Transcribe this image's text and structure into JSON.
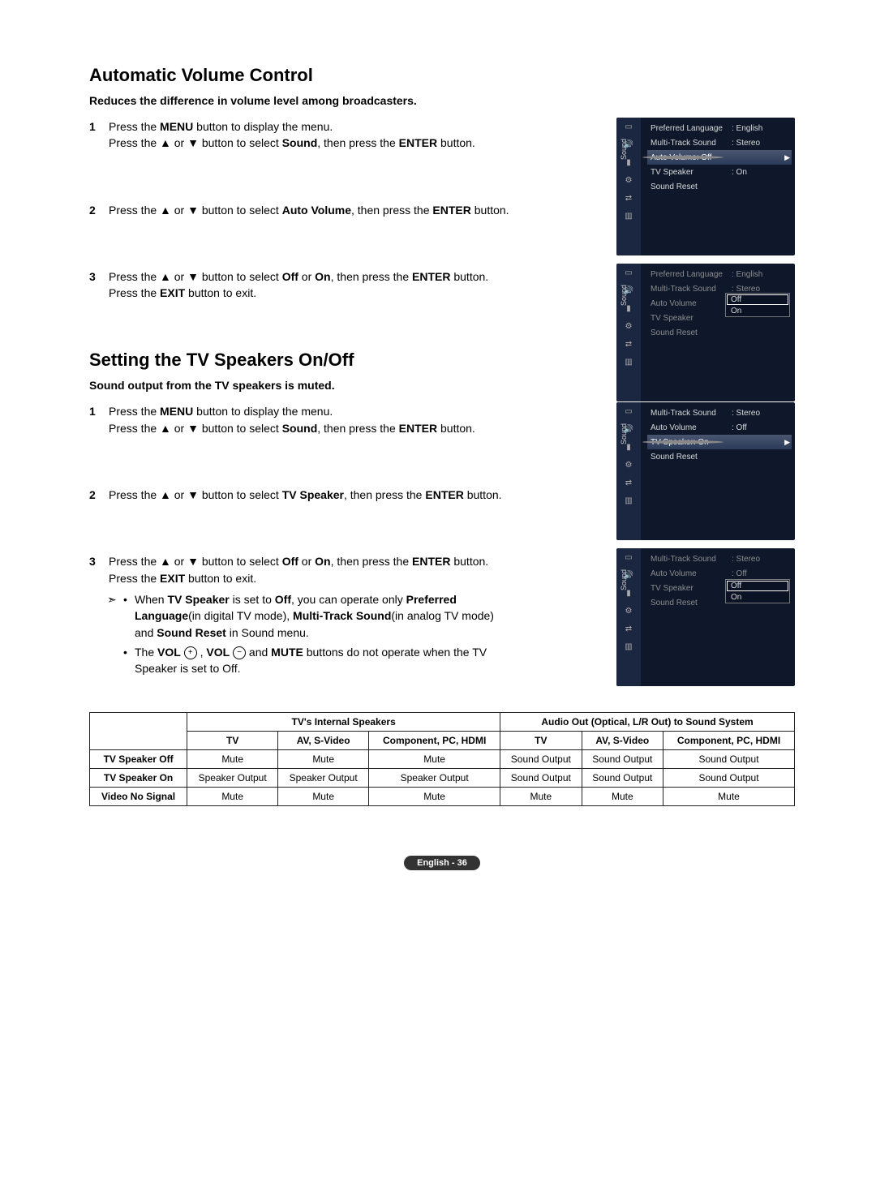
{
  "section1": {
    "title": "Automatic Volume Control",
    "subtitle": "Reduces the difference in volume level among broadcasters.",
    "steps": {
      "s1_pre": "Press the ",
      "s1_menu": "MENU",
      "s1_mid": " button to display the menu.",
      "s1_line2a": "Press the ▲ or ▼ button to select ",
      "s1_sound": "Sound",
      "s1_line2b": ", then press the ",
      "s1_enter": "ENTER",
      "s1_line2c": " button.",
      "s2a": "Press the ▲ or ▼ button to select ",
      "s2_av": "Auto Volume",
      "s2b": ", then press the ",
      "s2_enter": "ENTER",
      "s2c": " button.",
      "s3a": "Press the ▲ or ▼ button to select ",
      "s3_off": "Off",
      "s3_or": " or ",
      "s3_on": "On",
      "s3b": ", then press the ",
      "s3_enter": "ENTER",
      "s3c": " button.",
      "s3_exit_a": "Press the ",
      "s3_exit": "EXIT",
      "s3_exit_b": " button to exit."
    }
  },
  "section2": {
    "title": "Setting the TV Speakers On/Off",
    "subtitle": "Sound output from the TV speakers is muted.",
    "steps": {
      "s1_pre": "Press the ",
      "s1_menu": "MENU",
      "s1_mid": " button to display the menu.",
      "s1_line2a": "Press the ▲ or ▼ button to select ",
      "s1_sound": "Sound",
      "s1_line2b": ", then press the ",
      "s1_enter": "ENTER",
      "s1_line2c": " button.",
      "s2a": "Press the ▲ or ▼ button to select ",
      "s2_item": "TV Speaker",
      "s2b": ", then press the ",
      "s2_enter": "ENTER",
      "s2c": " button.",
      "s3a": "Press the ▲ or ▼ button to select ",
      "s3_off": "Off",
      "s3_or": " or ",
      "s3_on": "On",
      "s3b": ", then press the ",
      "s3_enter": "ENTER",
      "s3c": " button.",
      "s3_exit_a": "Press the ",
      "s3_exit": "EXIT",
      "s3_exit_b": " button to exit.",
      "note1a": "When ",
      "note1_tvs": "TV Speaker",
      "note1b": " is set to ",
      "note1_off": "Off",
      "note1c": ", you can operate only ",
      "note1_pref": "Preferred Language",
      "note1d": "(in digital TV mode), ",
      "note1_mts": "Multi-Track Sound",
      "note1e": "(in analog TV mode) and ",
      "note1_sr": "Sound Reset",
      "note1f": " in Sound menu.",
      "note2a": "The ",
      "note2_volp": "VOL",
      "note2_plus": "+",
      "note2_c1": " , ",
      "note2_volm": "VOL",
      "note2_minus": "−",
      "note2b": " and ",
      "note2_mute": "MUTE",
      "note2c": " buttons do not operate when the TV Speaker is set to Off."
    }
  },
  "osd": {
    "tab": "Sound",
    "pref_lang": "Preferred Language",
    "pref_lang_v": ": English",
    "mts": "Multi-Track Sound",
    "mts_v": ": Stereo",
    "autovol": "Auto Volume",
    "autovol_v": ": Off",
    "tvspk": "TV Speaker",
    "tvspk_v": ": On",
    "soundreset": "Sound Reset",
    "off_opt": "Off",
    "on_opt": "On"
  },
  "chart_data": {
    "type": "table",
    "title": "",
    "group_headers": [
      "TV's Internal Speakers",
      "Audio Out (Optical, L/R Out) to Sound System"
    ],
    "col_headers": [
      "TV",
      "AV, S-Video",
      "Component, PC, HDMI",
      "TV",
      "AV, S-Video",
      "Component, PC, HDMI"
    ],
    "rows": [
      {
        "label": "TV Speaker Off",
        "values": [
          "Mute",
          "Mute",
          "Mute",
          "Sound Output",
          "Sound Output",
          "Sound Output"
        ]
      },
      {
        "label": "TV Speaker On",
        "values": [
          "Speaker Output",
          "Speaker Output",
          "Speaker Output",
          "Sound Output",
          "Sound Output",
          "Sound Output"
        ]
      },
      {
        "label": "Video No Signal",
        "values": [
          "Mute",
          "Mute",
          "Mute",
          "Mute",
          "Mute",
          "Mute"
        ]
      }
    ]
  },
  "pagefoot": "English - 36"
}
